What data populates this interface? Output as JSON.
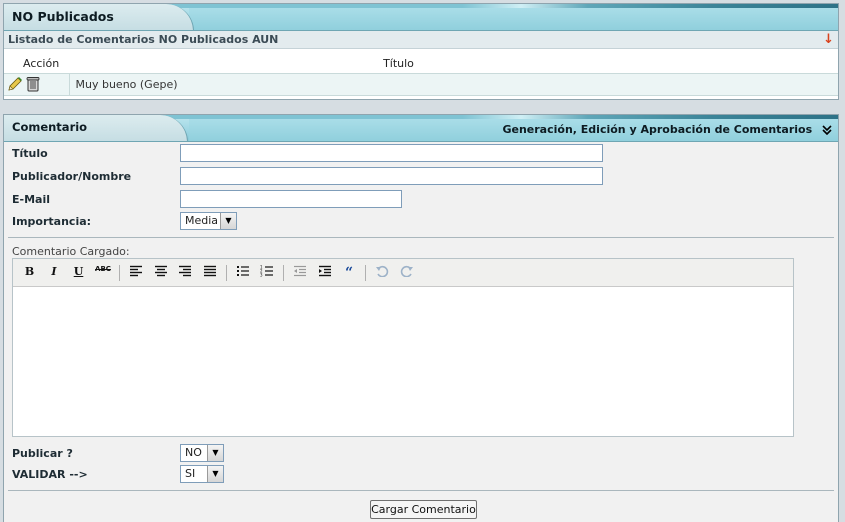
{
  "panel_published": {
    "title": "NO Publicados",
    "list_title": "Listado de Comentarios NO Publicados AUN",
    "columns": {
      "action": "Acción",
      "title": "Título"
    },
    "rows": [
      {
        "title": "Muy bueno (Gepe)"
      }
    ]
  },
  "panel_comment": {
    "title": "Comentario",
    "subtitle": "Generación, Edición y Aprobación de Comentarios",
    "fields": {
      "titulo_label": "Título",
      "publicador_label": "Publicador/Nombre",
      "email_label": "E-Mail",
      "importancia_label": "Importancia:",
      "importancia_value": "Media"
    },
    "editor_label": "Comentario Cargado:",
    "publicar_label": "Publicar ?",
    "publicar_value": "NO",
    "validar_label": "VALIDAR -->",
    "validar_value": "SI",
    "submit_label": "Cargar Comentario"
  },
  "toolbar_icons": [
    "bold-icon",
    "italic-icon",
    "underline-icon",
    "strikethrough-icon",
    "align-left-icon",
    "align-center-icon",
    "align-right-icon",
    "align-justify-icon",
    "bullet-list-icon",
    "numbered-list-icon",
    "outdent-icon",
    "indent-icon",
    "blockquote-icon",
    "undo-icon",
    "redo-icon"
  ],
  "colors": {
    "header_teal": "#9ed6e3",
    "row_bg": "#ecf5f5",
    "arrow_red": "#d9431e"
  }
}
